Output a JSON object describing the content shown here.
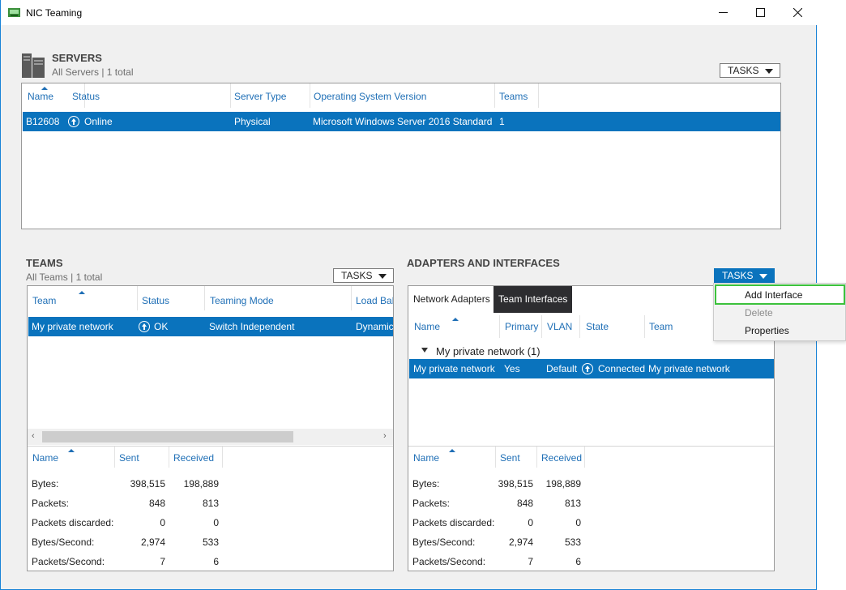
{
  "window": {
    "title": "NIC Teaming",
    "minimize": "—",
    "maximize": "☐",
    "close": "✕"
  },
  "servers": {
    "title": "SERVERS",
    "subtitle": "All Servers | 1 total",
    "tasks_label": "TASKS",
    "columns": [
      "Name",
      "Status",
      "Server Type",
      "Operating System Version",
      "Teams"
    ],
    "rows": [
      {
        "name": "B12608",
        "status": "Online",
        "server_type": "Physical",
        "os": "Microsoft Windows Server 2016 Standard",
        "teams": "1"
      }
    ]
  },
  "teams": {
    "title": "TEAMS",
    "subtitle": "All Teams | 1 total",
    "tasks_label": "TASKS",
    "columns": [
      "Team",
      "Status",
      "Teaming Mode",
      "Load Bal"
    ],
    "rows": [
      {
        "team": "My private network",
        "status": "OK",
        "mode": "Switch Independent",
        "load": "Dynamic"
      }
    ],
    "stats_columns": [
      "Name",
      "Sent",
      "Received"
    ],
    "stats": [
      {
        "label": "Bytes:",
        "sent": "398,515",
        "received": "198,889"
      },
      {
        "label": "Packets:",
        "sent": "848",
        "received": "813"
      },
      {
        "label": "Packets discarded:",
        "sent": "0",
        "received": "0"
      },
      {
        "label": "Bytes/Second:",
        "sent": "2,974",
        "received": "533"
      },
      {
        "label": "Packets/Second:",
        "sent": "7",
        "received": "6"
      }
    ]
  },
  "adapters": {
    "title": "ADAPTERS AND INTERFACES",
    "tasks_label": "TASKS",
    "tabs": [
      "Network Adapters",
      "Team Interfaces"
    ],
    "active_tab": "Team Interfaces",
    "columns": [
      "Name",
      "Primary",
      "VLAN",
      "State",
      "Team"
    ],
    "group_label": "My private network (1)",
    "rows": [
      {
        "name": "My private network",
        "primary": "Yes",
        "vlan": "Default",
        "state": "Connected",
        "team": "My private network"
      }
    ],
    "stats_columns": [
      "Name",
      "Sent",
      "Received"
    ],
    "stats": [
      {
        "label": "Bytes:",
        "sent": "398,515",
        "received": "198,889"
      },
      {
        "label": "Packets:",
        "sent": "848",
        "received": "813"
      },
      {
        "label": "Packets discarded:",
        "sent": "0",
        "received": "0"
      },
      {
        "label": "Bytes/Second:",
        "sent": "2,974",
        "received": "533"
      },
      {
        "label": "Packets/Second:",
        "sent": "7",
        "received": "6"
      }
    ]
  },
  "tasks_menu": {
    "items": [
      {
        "label": "Add Interface",
        "enabled": true,
        "highlighted": true
      },
      {
        "label": "Delete",
        "enabled": false
      },
      {
        "label": "Properties",
        "enabled": true
      }
    ]
  },
  "colors": {
    "accent": "#0a73bd",
    "header_text": "#1f6fb6",
    "highlight": "#3cc23c",
    "dark_tab": "#2d2d30"
  }
}
